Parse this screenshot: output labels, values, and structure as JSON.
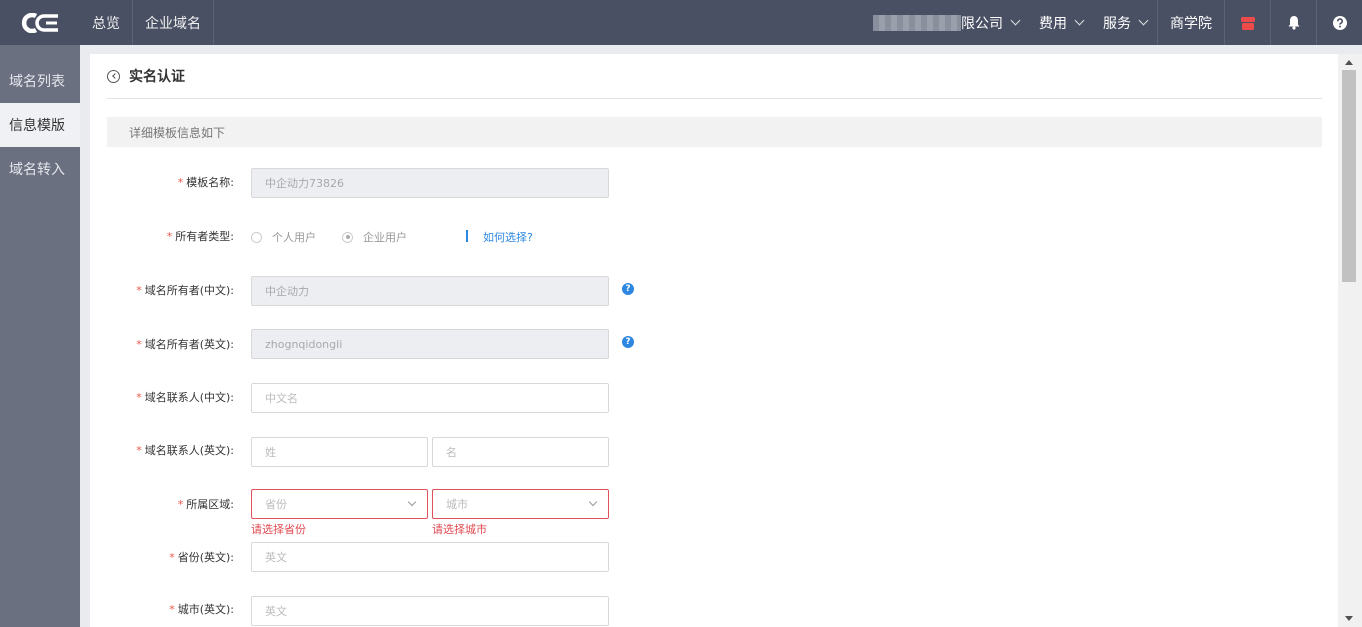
{
  "topbar": {
    "nav": [
      "总览",
      "企业域名"
    ],
    "company": "限公司",
    "menus": [
      "费用",
      "服务"
    ],
    "academy": "商学院"
  },
  "sidebar": {
    "items": [
      {
        "label": "域名列表"
      },
      {
        "label": "信息模版",
        "active": true
      },
      {
        "label": "域名转入"
      }
    ]
  },
  "page": {
    "title": "实名认证",
    "info": "详细模板信息如下"
  },
  "form": {
    "required_mark": "*",
    "template_name": {
      "label": "模板名称:",
      "value": "中企动力73826"
    },
    "owner_type": {
      "label": "所有者类型:",
      "options": [
        "个人用户",
        "企业用户"
      ],
      "selected": "企业用户",
      "help_link": "如何选择?"
    },
    "owner_cn": {
      "label": "域名所有者(中文):",
      "value": "中企动力"
    },
    "owner_en": {
      "label": "域名所有者(英文):",
      "value": "zhognqidongli"
    },
    "contact_cn": {
      "label": "域名联系人(中文):",
      "placeholder": "中文名"
    },
    "contact_en": {
      "label": "域名联系人(英文):",
      "placeholder_last": "姓",
      "placeholder_first": "名"
    },
    "region": {
      "label": "所属区域:",
      "province_placeholder": "省份",
      "city_placeholder": "城市",
      "province_error": "请选择省份",
      "city_error": "请选择城市"
    },
    "province_en": {
      "label": "省份(英文):",
      "placeholder": "英文"
    },
    "city_en": {
      "label": "城市(英文):",
      "placeholder": "英文"
    },
    "help_glyph": "?"
  },
  "colors": {
    "topbar": "#4a5064",
    "sidebar": "#6b7081",
    "required": "#e9574a",
    "link": "#2d87e0",
    "error": "#e04a52"
  }
}
